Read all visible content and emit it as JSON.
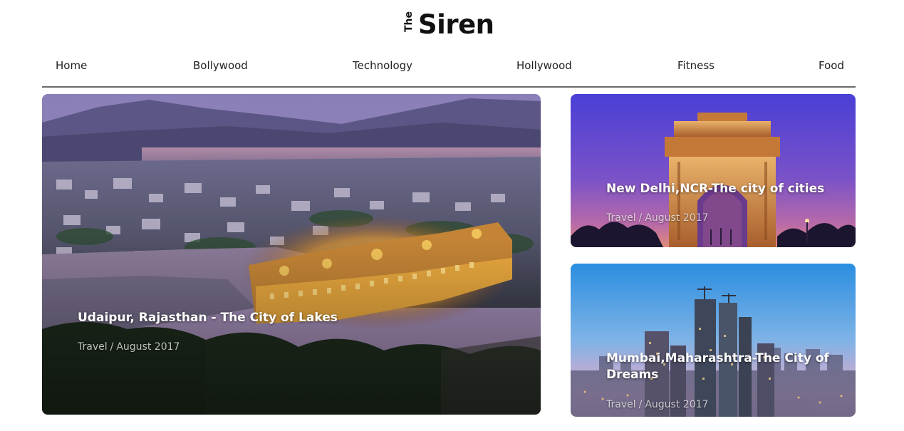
{
  "logo": {
    "the": "The",
    "siren": "Siren"
  },
  "nav": {
    "items": [
      {
        "label": "Home"
      },
      {
        "label": "Bollywood"
      },
      {
        "label": "Technology"
      },
      {
        "label": "Hollywood"
      },
      {
        "label": "Fitness"
      },
      {
        "label": "Food"
      }
    ]
  },
  "featured": {
    "title": "Udaipur, Rajasthan - The City of Lakes",
    "category": "Travel",
    "separator": "/",
    "date": "August 2017"
  },
  "side_posts": [
    {
      "title": "New Delhi,NCR-The city of cities",
      "category": "Travel",
      "separator": "/",
      "date": "August 2017"
    },
    {
      "title": "Mumbai,Maharashtra-The City of Dreams",
      "category": "Travel",
      "separator": "/",
      "date": "August 2017"
    }
  ],
  "colors": {
    "nav_rule": "#6a6a6a",
    "card_title": "#ffffff",
    "card_meta": "rgba(255,255,255,0.72)"
  }
}
